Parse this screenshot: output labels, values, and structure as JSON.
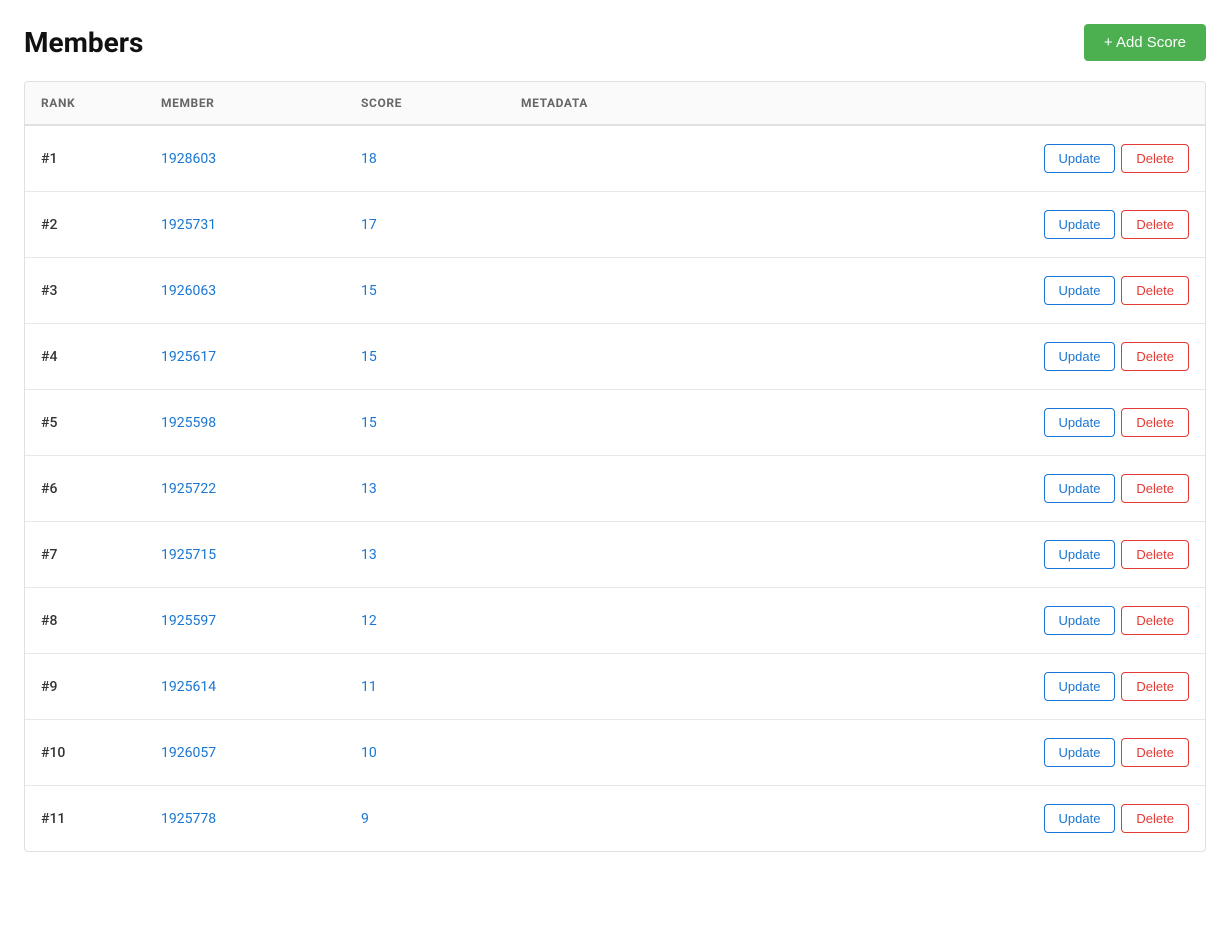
{
  "header": {
    "title": "Members",
    "add_button_label": "+ Add Score"
  },
  "table": {
    "columns": [
      {
        "key": "rank",
        "label": "RANK"
      },
      {
        "key": "member",
        "label": "MEMBER"
      },
      {
        "key": "score",
        "label": "SCORE"
      },
      {
        "key": "metadata",
        "label": "METADATA"
      },
      {
        "key": "actions",
        "label": ""
      }
    ],
    "rows": [
      {
        "rank": "#1",
        "member": "1928603",
        "score": "18",
        "metadata": ""
      },
      {
        "rank": "#2",
        "member": "1925731",
        "score": "17",
        "metadata": ""
      },
      {
        "rank": "#3",
        "member": "1926063",
        "score": "15",
        "metadata": ""
      },
      {
        "rank": "#4",
        "member": "1925617",
        "score": "15",
        "metadata": ""
      },
      {
        "rank": "#5",
        "member": "1925598",
        "score": "15",
        "metadata": ""
      },
      {
        "rank": "#6",
        "member": "1925722",
        "score": "13",
        "metadata": ""
      },
      {
        "rank": "#7",
        "member": "1925715",
        "score": "13",
        "metadata": ""
      },
      {
        "rank": "#8",
        "member": "1925597",
        "score": "12",
        "metadata": ""
      },
      {
        "rank": "#9",
        "member": "1925614",
        "score": "11",
        "metadata": ""
      },
      {
        "rank": "#10",
        "member": "1926057",
        "score": "10",
        "metadata": ""
      },
      {
        "rank": "#11",
        "member": "1925778",
        "score": "9",
        "metadata": ""
      }
    ],
    "update_label": "Update",
    "delete_label": "Delete"
  }
}
